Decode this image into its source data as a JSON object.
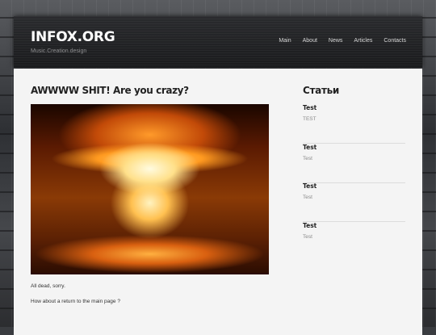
{
  "header": {
    "logo": "INFOX.ORG",
    "tagline": "Music.Creation.design",
    "nav": [
      "Main",
      "About",
      "News",
      "Articles",
      "Contacts"
    ]
  },
  "main": {
    "title": "AWWWW SHIT! Are you crazy?",
    "image_alt": "nuclear explosion",
    "text1": "All dead, sorry.",
    "text2": "How about a return to the main page ?"
  },
  "sidebar": {
    "title": "Статьи",
    "items": [
      {
        "title": "Test",
        "desc": "TEST"
      },
      {
        "title": "Test",
        "desc": "Test"
      },
      {
        "title": "Test",
        "desc": "Test"
      },
      {
        "title": "Test",
        "desc": "Test"
      }
    ]
  }
}
